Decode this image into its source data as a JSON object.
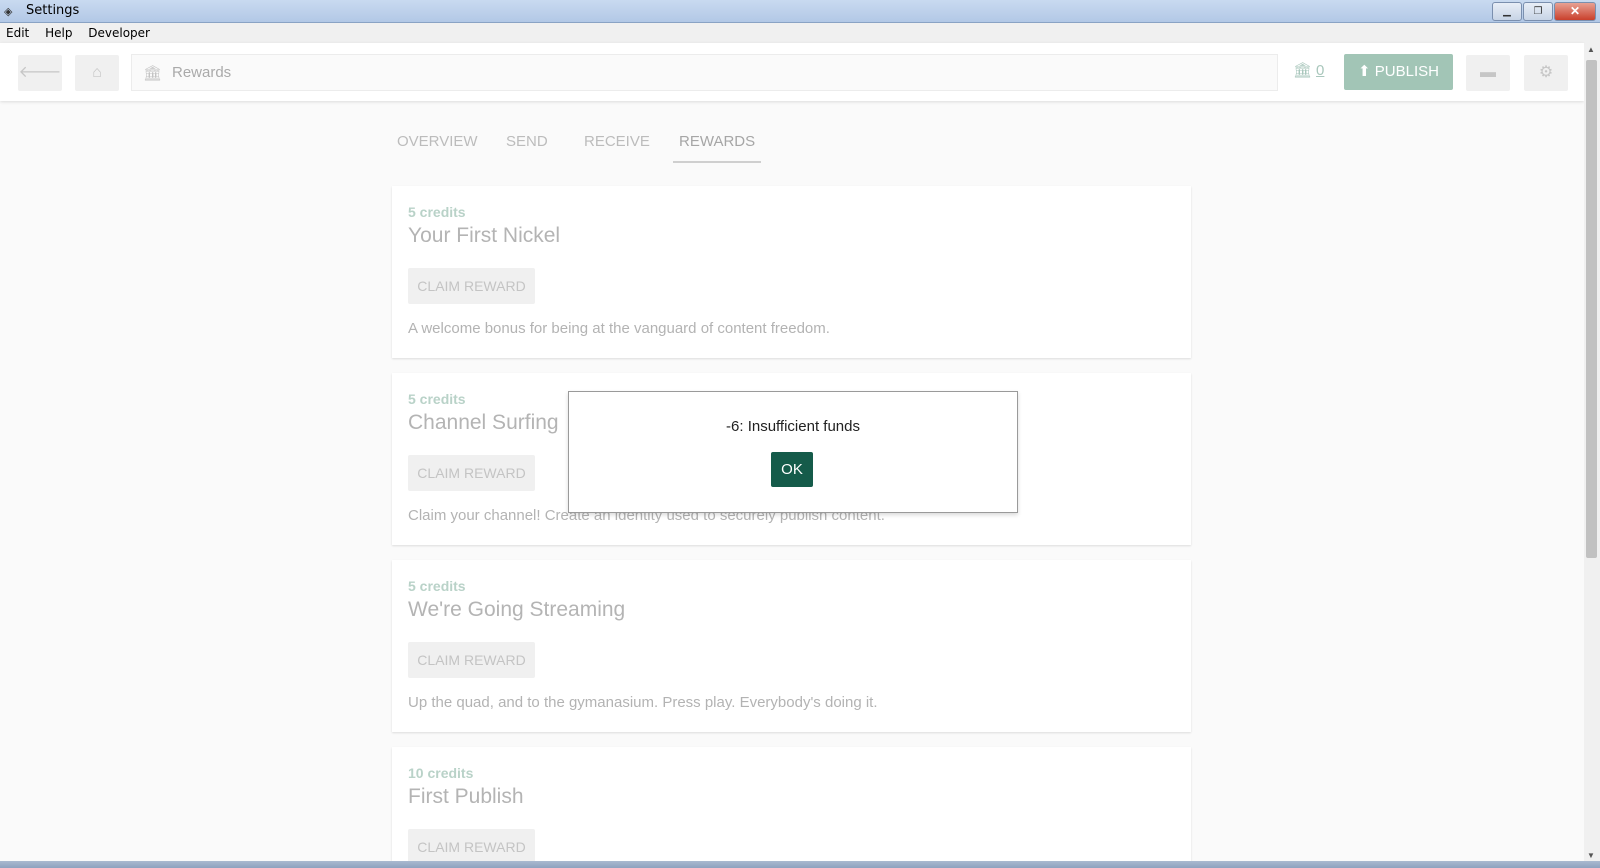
{
  "window": {
    "title": "Settings"
  },
  "menu": [
    "Edit",
    "Help",
    "Developer"
  ],
  "header": {
    "address_value": "Rewards",
    "balance": "0",
    "publish_label": "PUBLISH"
  },
  "tabs": [
    {
      "label": "OVERVIEW"
    },
    {
      "label": "SEND"
    },
    {
      "label": "RECEIVE"
    },
    {
      "label": "REWARDS"
    }
  ],
  "rewards": [
    {
      "credits": "5 credits",
      "title": "Your First Nickel",
      "claim": "CLAIM REWARD",
      "description": "A welcome bonus for being at the vanguard of content freedom."
    },
    {
      "credits": "5 credits",
      "title": "Channel Surfing",
      "claim": "CLAIM REWARD",
      "description": "Claim your channel! Create an identity used to securely publish content."
    },
    {
      "credits": "5 credits",
      "title": "We're Going Streaming",
      "claim": "CLAIM REWARD",
      "description": "Up the quad, and to the gymanasium. Press play. Everybody's doing it."
    },
    {
      "credits": "10 credits",
      "title": "First Publish",
      "claim": "CLAIM REWARD",
      "description": ""
    }
  ],
  "dialog": {
    "message": "-6: Insufficient funds",
    "ok_label": "OK"
  },
  "colors": {
    "accent": "#155b4a",
    "publish_bg": "#a2c5b6",
    "credits_text": "#b9d2c8"
  },
  "icons": [
    "back-arrow-icon",
    "home-icon",
    "bank-icon",
    "upload-icon",
    "folder-icon",
    "gear-icon"
  ]
}
